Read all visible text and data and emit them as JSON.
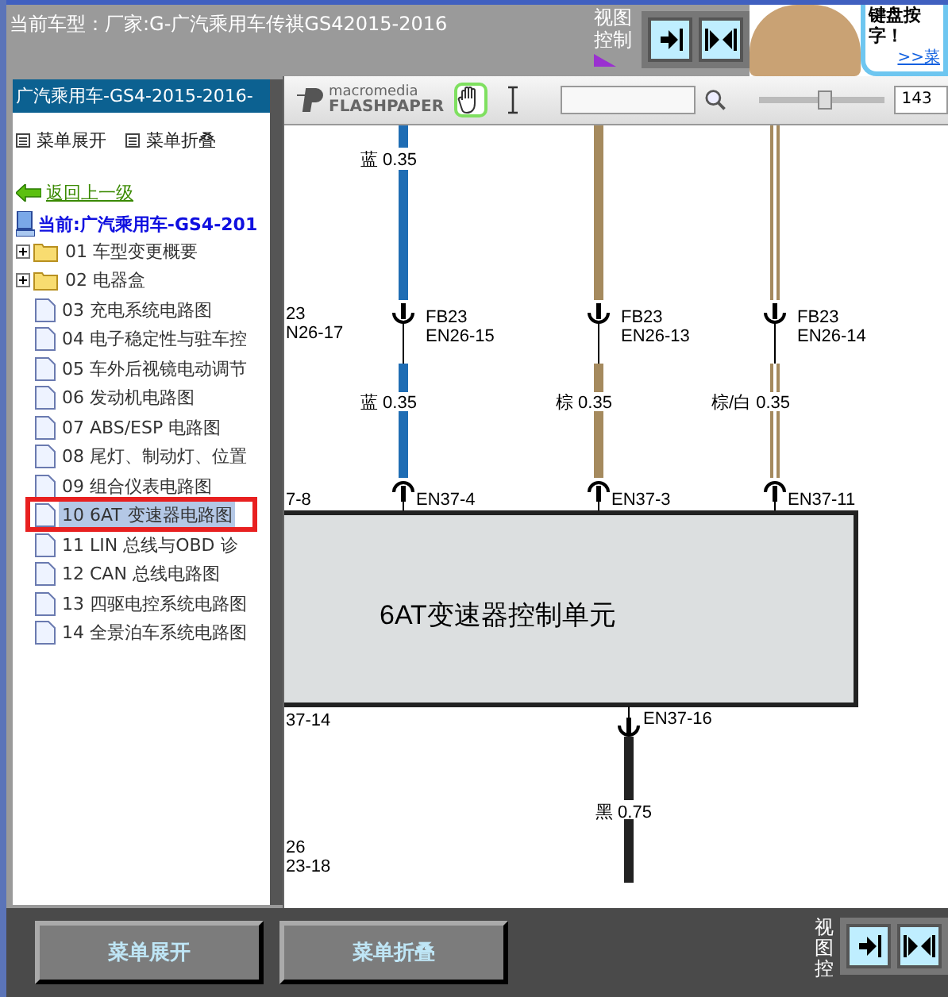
{
  "header": {
    "title": "当前车型：厂家:G-广汽乘用车传祺GS42015-2016",
    "view_control_label": "视图控制",
    "view_buttons": [
      {
        "kind": "fit-page"
      },
      {
        "kind": "fit-width"
      }
    ]
  },
  "ad": {
    "text": "键盘按字！",
    "link": ">>菜"
  },
  "sidebar": {
    "title": "广汽乘用车-GS4-2015-2016-",
    "expand": "菜单展开",
    "collapse": "菜单折叠",
    "back": "返回上一级",
    "current": "当前:广汽乘用车-GS4-201",
    "items": [
      {
        "label": "01 车型变更概要",
        "kind": "folder",
        "selected": false
      },
      {
        "label": "02 电器盒",
        "kind": "folder",
        "selected": false
      },
      {
        "label": "03 充电系统电路图",
        "kind": "doc",
        "selected": false
      },
      {
        "label": "04 电子稳定性与驻车控",
        "kind": "doc",
        "selected": false
      },
      {
        "label": "05 车外后视镜电动调节",
        "kind": "doc",
        "selected": false
      },
      {
        "label": "06 发动机电路图",
        "kind": "doc",
        "selected": false
      },
      {
        "label": "07 ABS/ESP 电路图",
        "kind": "doc",
        "selected": false
      },
      {
        "label": "08 尾灯、制动灯、位置",
        "kind": "doc",
        "selected": false
      },
      {
        "label": "09 组合仪表电路图",
        "kind": "doc",
        "selected": false
      },
      {
        "label": "10 6AT 变速器电路图",
        "kind": "doc",
        "selected": true
      },
      {
        "label": "11 LIN 总线与OBD 诊",
        "kind": "doc",
        "selected": false
      },
      {
        "label": "12 CAN 总线电路图",
        "kind": "doc",
        "selected": false
      },
      {
        "label": "13 四驱电控系统电路图",
        "kind": "doc",
        "selected": false
      },
      {
        "label": "14 全景泊车系统电路图",
        "kind": "doc",
        "selected": false
      }
    ]
  },
  "viewer": {
    "brand_top": "macromedia",
    "brand_bottom": "FLASHPAPER",
    "tools": [
      {
        "kind": "hand",
        "selected": true
      },
      {
        "kind": "text-select",
        "selected": false
      }
    ],
    "level": 0.52,
    "zoom": "143"
  },
  "diagram": {
    "unit": "6AT变速器控制单元",
    "wires": [
      {
        "kind": "solid",
        "color": "#1f6db4",
        "top_label": "蓝 0.35",
        "connector": [
          "FB23",
          "EN26-15"
        ],
        "lower_label": "蓝 0.35",
        "pin": "EN37-4"
      },
      {
        "kind": "solid",
        "color": "#a58a5e",
        "connector": [
          "FB23",
          "EN26-13"
        ],
        "lower_label": "棕 0.35",
        "pin": "EN37-3"
      },
      {
        "kind": "striped",
        "color": "#a58a5e",
        "connector": [
          "FB23",
          "EN26-14"
        ],
        "lower_label": "棕/白 0.35",
        "pin": "EN37-11"
      }
    ],
    "ground_wire": {
      "color": "#222222",
      "pin": "EN37-16",
      "label": "黑 0.75"
    },
    "edge_labels": [
      "23",
      "N26-17",
      "7-8",
      "37-14",
      "26",
      "23-18"
    ]
  },
  "bottom": {
    "buttons": [
      "菜单展开",
      "菜单折叠"
    ],
    "view_control_label": "视图控"
  }
}
